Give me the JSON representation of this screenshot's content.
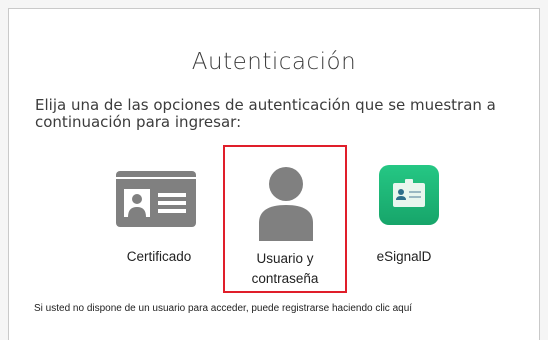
{
  "title": "Autenticación",
  "instruction": "Elija una de las opciones de autenticación que se muestran a continuación para ingresar:",
  "options": [
    {
      "label": "Certificado",
      "icon": "id-card-icon",
      "selected": false
    },
    {
      "label_line1": "Usuario y",
      "label_line2": "contraseña",
      "icon": "user-silhouette-icon",
      "selected": true
    },
    {
      "label": "eSignalD",
      "icon": "badge-app-icon",
      "selected": false
    }
  ],
  "footer": {
    "text": "Si usted no dispone de un usuario para acceder, puede registrarse haciendo clic ",
    "link_text": "aquí"
  },
  "colors": {
    "icon_gray": "#808080",
    "selected_border": "#e01e2a",
    "esignal_green": "#1fb97a"
  }
}
